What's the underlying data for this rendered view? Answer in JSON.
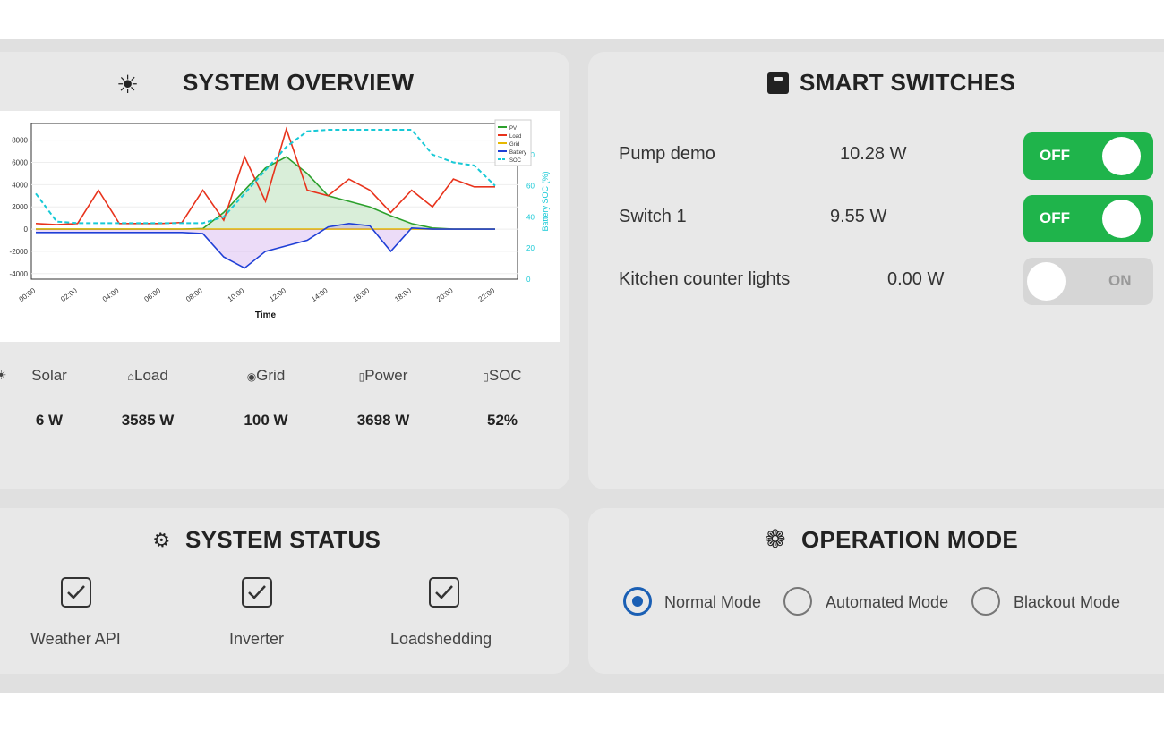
{
  "overview": {
    "title": "SYSTEM OVERVIEW",
    "icon": "sun-icon",
    "metrics": [
      {
        "label": "Solar",
        "icon": "sun-icon",
        "value": "6 W"
      },
      {
        "label": "Load",
        "icon": "house-icon",
        "value": "3585 W"
      },
      {
        "label": "Grid",
        "icon": "globe-icon",
        "value": "100 W"
      },
      {
        "label": "Power",
        "icon": "battery-icon",
        "value": "3698 W"
      },
      {
        "label": "SOC",
        "icon": "battery-icon",
        "value": "52%"
      }
    ]
  },
  "chart_data": {
    "type": "line",
    "title": "",
    "xlabel": "Time",
    "ylabel": "",
    "y2label": "Battery SOC (%)",
    "x": [
      "00:00",
      "01:00",
      "02:00",
      "03:00",
      "04:00",
      "05:00",
      "06:00",
      "07:00",
      "08:00",
      "09:00",
      "10:00",
      "11:00",
      "12:00",
      "13:00",
      "14:00",
      "15:00",
      "16:00",
      "17:00",
      "18:00",
      "19:00",
      "20:00",
      "21:00",
      "22:00"
    ],
    "xticks": [
      "00:00",
      "02:00",
      "04:00",
      "06:00",
      "08:00",
      "10:00",
      "12:00",
      "14:00",
      "16:00",
      "18:00",
      "20:00",
      "22:00"
    ],
    "ylim": [
      -4500,
      9500
    ],
    "yticks": [
      -4000,
      -2000,
      0,
      2000,
      4000,
      6000,
      8000
    ],
    "y2lim": [
      0,
      100
    ],
    "y2ticks": [
      0,
      20,
      40,
      60,
      80
    ],
    "grid": true,
    "legend": "top-right",
    "series": [
      {
        "name": "PV",
        "axis": "left",
        "color": "#2ca02c",
        "values": [
          0,
          0,
          0,
          0,
          0,
          0,
          0,
          0,
          50,
          1500,
          3500,
          5500,
          6500,
          5000,
          3000,
          2500,
          2000,
          1200,
          500,
          100,
          0,
          0,
          0
        ]
      },
      {
        "name": "Load",
        "axis": "left",
        "color": "#e8331c",
        "values": [
          500,
          400,
          500,
          3500,
          500,
          500,
          500,
          600,
          3500,
          800,
          6500,
          2500,
          9000,
          3500,
          3000,
          4500,
          3500,
          1500,
          3500,
          2000,
          4500,
          3800,
          3800
        ]
      },
      {
        "name": "Grid",
        "axis": "left",
        "color": "#e6b800",
        "values": [
          0,
          0,
          0,
          0,
          0,
          0,
          0,
          0,
          0,
          0,
          0,
          0,
          0,
          0,
          0,
          0,
          0,
          0,
          0,
          0,
          0,
          0,
          0
        ]
      },
      {
        "name": "Battery",
        "axis": "left",
        "color": "#1f3fd6",
        "values": [
          -300,
          -300,
          -300,
          -300,
          -300,
          -300,
          -300,
          -300,
          -400,
          -2500,
          -3500,
          -2000,
          -1500,
          -1000,
          200,
          500,
          300,
          -2000,
          100,
          0,
          0,
          0,
          0
        ]
      },
      {
        "name": "SOC",
        "axis": "right",
        "color": "#17c9d6",
        "dashed": true,
        "values": [
          55,
          37,
          36,
          36,
          36,
          36,
          36,
          36,
          36,
          40,
          55,
          70,
          85,
          95,
          96,
          96,
          96,
          96,
          96,
          80,
          75,
          73,
          60
        ]
      }
    ]
  },
  "switches": {
    "title": "SMART SWITCHES",
    "icon": "box-icon",
    "items": [
      {
        "name": "Pump demo",
        "power": "10.28 W",
        "state": "OFF",
        "on": true
      },
      {
        "name": "Switch 1",
        "power": "9.55 W",
        "state": "OFF",
        "on": true
      },
      {
        "name": "Kitchen counter lights",
        "power": "0.00 W",
        "state": "ON",
        "on": false
      }
    ]
  },
  "status": {
    "title": "SYSTEM STATUS",
    "icon": "wrench-icon",
    "items": [
      {
        "label": "Weather API",
        "checked": true
      },
      {
        "label": "Inverter",
        "checked": true
      },
      {
        "label": "Loadshedding",
        "checked": true
      }
    ]
  },
  "mode": {
    "title": "OPERATION MODE",
    "icon": "gear-icon",
    "options": [
      {
        "label": "Normal Mode",
        "selected": true
      },
      {
        "label": "Automated Mode",
        "selected": false
      },
      {
        "label": "Blackout Mode",
        "selected": false
      }
    ]
  }
}
